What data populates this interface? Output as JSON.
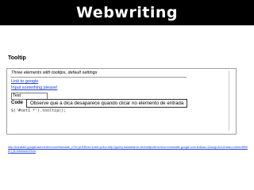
{
  "header": {
    "title": "Webwriting"
  },
  "slide": {
    "heading": "Tooltip"
  },
  "demo": {
    "title": "Three elements with tooltips, default settings",
    "link_label": "Link to google",
    "input_link_label": "Input something please!",
    "input_value": "Test",
    "code_label": "Code",
    "code_line": "$('#set1 *').tooltip();"
  },
  "tooltip": {
    "text": "Observe que a dica desaparece quando clicar no elemento de entrada"
  },
  "source": {
    "url": "http://translate.googleusercontent.com/translate_c?hl=pt-BR&sl=en&tl=pt&u=http://jquery.bassistance.de/tooltip/demo/&rurl=translate.google.com.br&twu=1&usg=ALkJrhaau-LebmU8f50eH_B-DiMwsxlrG9ow"
  },
  "colors": {
    "header_bg": "#000000",
    "header_text": "#ffffff",
    "link": "#1a3fd8"
  }
}
